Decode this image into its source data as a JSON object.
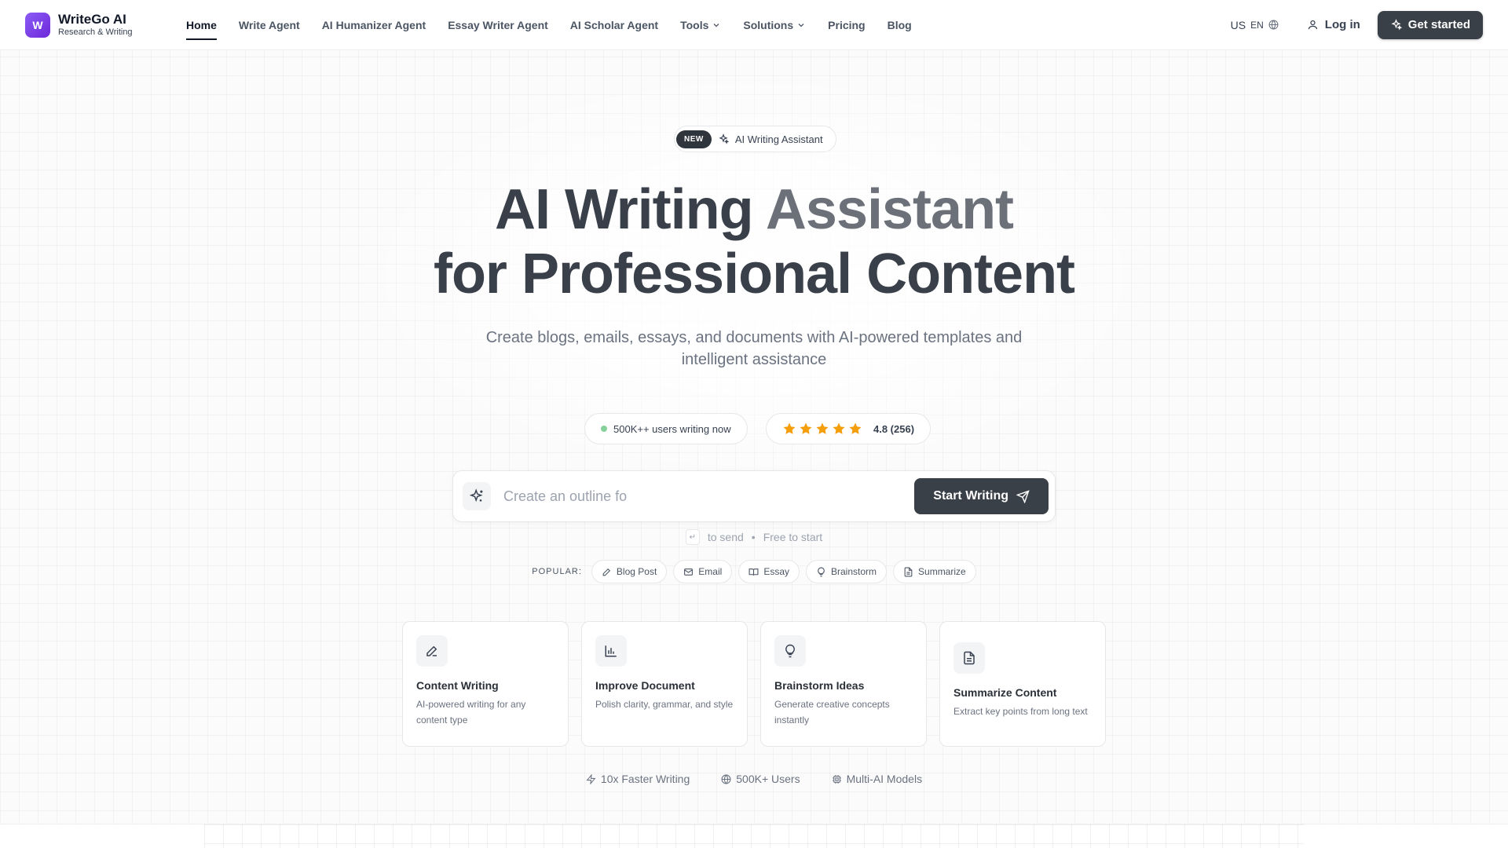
{
  "brand": {
    "name": "WriteGo AI",
    "tagline": "Research & Writing",
    "mark": "W"
  },
  "nav": {
    "items": [
      {
        "label": "Home"
      },
      {
        "label": "Write Agent"
      },
      {
        "label": "AI Humanizer Agent"
      },
      {
        "label": "Essay Writer Agent"
      },
      {
        "label": "AI Scholar Agent"
      },
      {
        "label": "Tools"
      },
      {
        "label": "Solutions"
      },
      {
        "label": "Pricing"
      },
      {
        "label": "Blog"
      }
    ],
    "region": "US",
    "language": "EN",
    "login": "Log in",
    "cta": "Get started"
  },
  "hero": {
    "badge_new": "NEW",
    "badge_label": "AI Writing Assistant",
    "title_dark": "AI Writing ",
    "title_gray": "Assistant",
    "title_line2": "for Professional Content",
    "subtitle": "Create blogs, emails, essays, and documents with AI-powered templates and intelligent assistance",
    "users_live": "500K++ users writing now",
    "rating": "4.8 (256)"
  },
  "prompt": {
    "value": "Create an outline fo",
    "placeholder": "Create an outline fo",
    "button": "Start Writing",
    "hint_send": "to send",
    "hint_free": "Free to start",
    "kbd": "↵"
  },
  "popular": {
    "label": "POPULAR:",
    "chips": [
      "Blog Post",
      "Email",
      "Essay",
      "Brainstorm",
      "Summarize"
    ]
  },
  "cards": [
    {
      "title": "Content Writing",
      "desc": "AI-powered writing for any content type"
    },
    {
      "title": "Improve Document",
      "desc": "Polish clarity, grammar, and style"
    },
    {
      "title": "Brainstorm Ideas",
      "desc": "Generate creative concepts instantly"
    },
    {
      "title": "Summarize Content",
      "desc": "Extract key points from long text"
    }
  ],
  "stats": [
    "10x Faster Writing",
    "500K+ Users",
    "Multi-AI Models"
  ],
  "colors": {
    "primary_dark": "#3a4048",
    "brand_purple": "#7c3aed",
    "star": "#f59e0b",
    "live_dot": "#86d19a"
  }
}
